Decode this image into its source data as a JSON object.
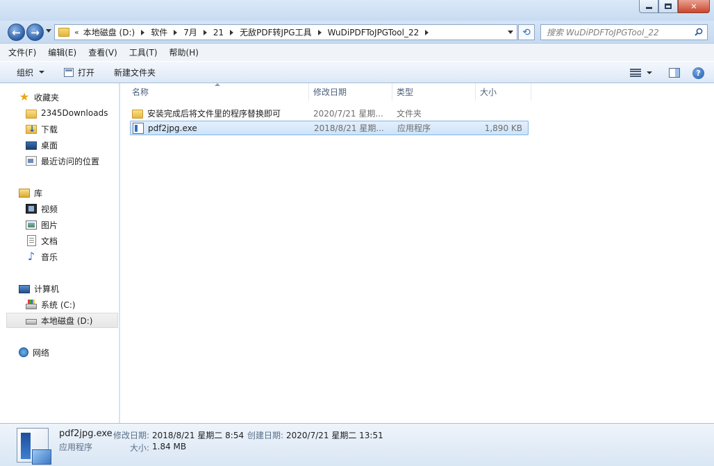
{
  "window": {
    "minimize_icon": "minimize-icon",
    "maximize_icon": "maximize-icon",
    "close_icon": "close-icon",
    "close_glyph": "✕"
  },
  "address": {
    "prefix": "«",
    "crumbs": [
      "本地磁盘 (D:)",
      "软件",
      "7月",
      "21",
      "无敌PDF转JPG工具",
      "WuDiPDFToJPGTool_22"
    ],
    "search_placeholder": "搜索 WuDiPDFToJPGTool_22"
  },
  "menu": [
    "文件(F)",
    "编辑(E)",
    "查看(V)",
    "工具(T)",
    "帮助(H)"
  ],
  "toolbar": {
    "organize": "组织",
    "open": "打开",
    "new_folder": "新建文件夹",
    "help_glyph": "?"
  },
  "sidebar": {
    "favorites": "收藏夹",
    "favorites_items": [
      "2345Downloads",
      "下载",
      "桌面",
      "最近访问的位置"
    ],
    "libraries": "库",
    "library_items": [
      "视频",
      "图片",
      "文档",
      "音乐"
    ],
    "computer": "计算机",
    "computer_items": [
      "系统 (C:)",
      "本地磁盘 (D:)"
    ],
    "network": "网络"
  },
  "columns": [
    "名称",
    "修改日期",
    "类型",
    "大小"
  ],
  "files": [
    {
      "name": "安装完成后将文件里的程序替换即可",
      "date": "2020/7/21 星期...",
      "type": "文件夹",
      "size": ""
    },
    {
      "name": "pdf2jpg.exe",
      "date": "2018/8/21 星期...",
      "type": "应用程序",
      "size": "1,890 KB"
    }
  ],
  "details": {
    "filename": "pdf2jpg.exe",
    "filetype": "应用程序",
    "modified_label": "修改日期:",
    "modified_value": "2018/8/21 星期二 8:54",
    "created_label": "创建日期:",
    "created_value": "2020/7/21 星期二 13:51",
    "size_label": "大小:",
    "size_value": "1.84 MB"
  }
}
